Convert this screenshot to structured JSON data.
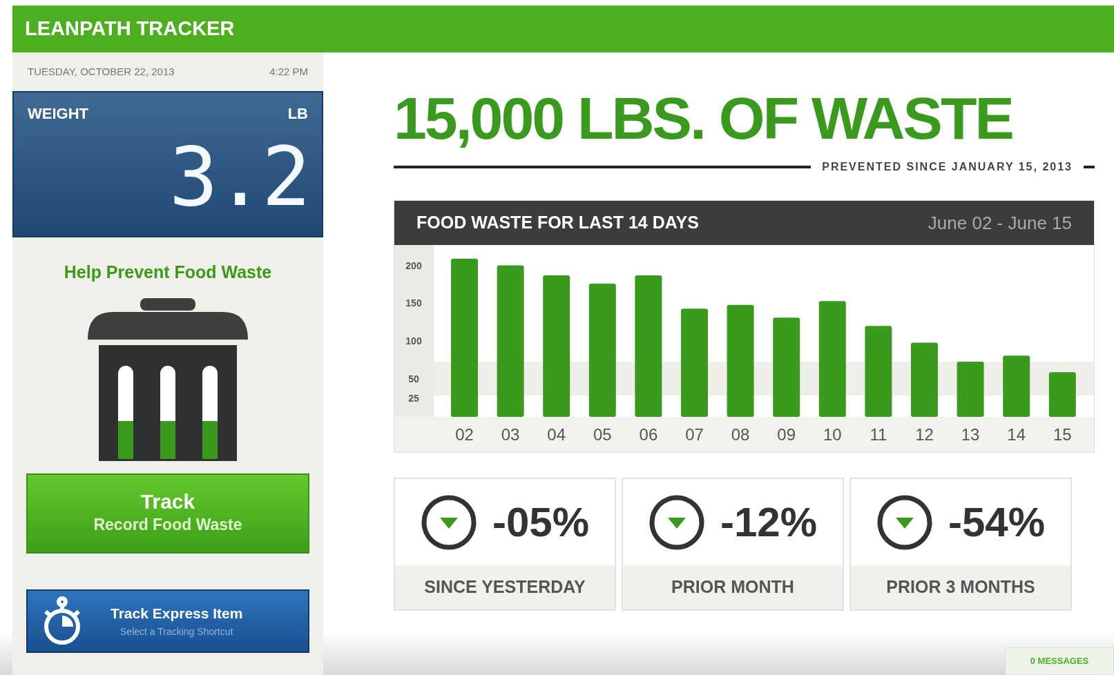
{
  "header": {
    "title": "LEANPATH TRACKER"
  },
  "sidebar": {
    "date": "TUESDAY, OCTOBER 22, 2013",
    "time": "4:22 PM",
    "weight": {
      "label": "WEIGHT",
      "unit": "LB",
      "value": "3.2"
    },
    "prompt": "Help Prevent Food Waste",
    "track_button": {
      "title": "Track",
      "subtitle": "Record Food Waste"
    },
    "express_button": {
      "title": "Track Express Item",
      "subtitle": "Select a Tracking Shortcut"
    }
  },
  "headline": {
    "title": "15,000 LBS. OF WASTE",
    "subtitle": "PREVENTED SINCE JANUARY 15, 2013"
  },
  "chart_panel": {
    "title": "FOOD WASTE FOR LAST 14 DAYS",
    "range": "June 02 - June 15",
    "chart_data": {
      "type": "bar",
      "categories": [
        "02",
        "03",
        "04",
        "05",
        "06",
        "07",
        "08",
        "09",
        "10",
        "11",
        "12",
        "13",
        "14",
        "15"
      ],
      "series": [
        {
          "color": "#3a9a1e",
          "values": [
            209,
            200,
            187,
            176,
            187,
            143,
            148,
            131,
            153,
            120,
            98,
            73,
            81,
            59
          ]
        }
      ],
      "ylim": [
        0,
        227
      ],
      "yticks": [
        25,
        50,
        100,
        150,
        200
      ]
    }
  },
  "stats": [
    {
      "value": "-05%",
      "label": "SINCE YESTERDAY",
      "kind": "down"
    },
    {
      "value": "-12%",
      "label": "PRIOR MONTH",
      "kind": "down"
    },
    {
      "value": "-54%",
      "label": "PRIOR 3 MONTHS",
      "kind": "down"
    }
  ],
  "messages": {
    "label": "0 MESSAGES"
  }
}
